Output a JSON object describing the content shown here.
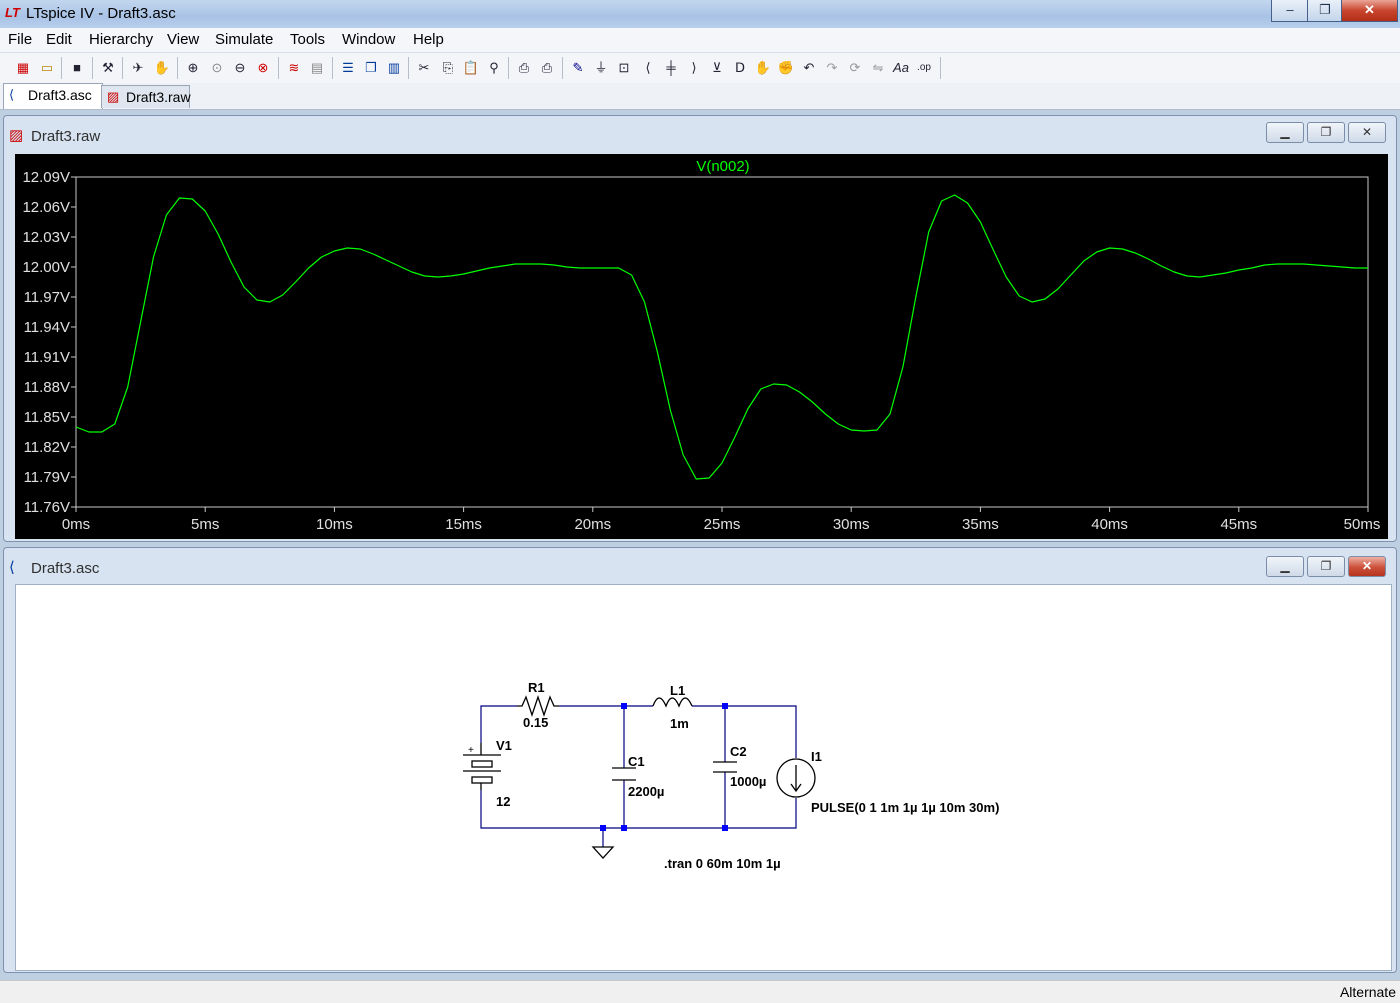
{
  "app": {
    "title": "LTspice IV - Draft3.asc",
    "logo_icon": "ltspice-logo-icon"
  },
  "caption_buttons": {
    "minimize": "–",
    "maximize": "❐",
    "close": "✕"
  },
  "menu": [
    {
      "label": "File"
    },
    {
      "label": "Edit"
    },
    {
      "label": "Hierarchy"
    },
    {
      "label": "View"
    },
    {
      "label": "Simulate"
    },
    {
      "label": "Tools"
    },
    {
      "label": "Window"
    },
    {
      "label": "Help"
    }
  ],
  "toolbar_icons": [
    "new-schematic-icon",
    "open-icon",
    "save-icon",
    "control-panel-icon",
    "run-icon",
    "pan-icon",
    "zoom-in-icon",
    "zoom-area-icon",
    "zoom-out-icon",
    "zoom-cancel-icon",
    "autorange-icon",
    "grid-icon",
    "tile-horizontal-icon",
    "cascade-icon",
    "tile-vertical-icon",
    "cut-icon",
    "copy-icon",
    "paste-icon",
    "find-icon",
    "print-preview-icon",
    "print-icon",
    "wire-icon",
    "ground-icon",
    "label-icon",
    "resistor-icon",
    "capacitor-icon",
    "inductor-icon",
    "diode-icon",
    "component-icon",
    "move-icon",
    "drag-icon",
    "undo-icon",
    "redo-icon",
    "rotate-icon",
    "mirror-icon",
    "text-icon",
    "spice-directive-icon"
  ],
  "tabs": [
    {
      "label": "Draft3.asc",
      "active": true
    },
    {
      "label": "Draft3.raw",
      "active": false
    }
  ],
  "waveform_window": {
    "title": "Draft3.raw",
    "trace_label": "V(n002)"
  },
  "chart_data": {
    "type": "line",
    "title": "V(n002)",
    "xlabel": "",
    "ylabel": "",
    "xlim": [
      0,
      50
    ],
    "ylim": [
      11.76,
      12.09
    ],
    "x_ticks": [
      "0ms",
      "5ms",
      "10ms",
      "15ms",
      "20ms",
      "25ms",
      "30ms",
      "35ms",
      "40ms",
      "45ms",
      "50ms"
    ],
    "y_ticks": [
      "12.09V",
      "12.06V",
      "12.03V",
      "12.00V",
      "11.97V",
      "11.94V",
      "11.91V",
      "11.88V",
      "11.85V",
      "11.82V",
      "11.79V",
      "11.76V"
    ],
    "series": [
      {
        "color": "#00ff00",
        "x": [
          0,
          0.5,
          1,
          1.5,
          2,
          2.5,
          3,
          3.5,
          4,
          4.5,
          5,
          5.5,
          6,
          6.5,
          7,
          7.5,
          8,
          8.5,
          9,
          9.5,
          10,
          10.5,
          11,
          11.5,
          12,
          12.5,
          13,
          13.5,
          14,
          14.5,
          15,
          15.5,
          16,
          16.5,
          17,
          17.5,
          18,
          18.5,
          19,
          19.5,
          20,
          20.5,
          21,
          21.5,
          22,
          22.5,
          23,
          23.5,
          24,
          24.5,
          25,
          25.5,
          26,
          26.5,
          27,
          27.5,
          28,
          28.5,
          29,
          29.5,
          30,
          30.5,
          31,
          31.5,
          32,
          32.5,
          33,
          33.5,
          34,
          34.5,
          35,
          35.5,
          36,
          36.5,
          37,
          37.5,
          38,
          38.5,
          39,
          39.5,
          40,
          40.5,
          41,
          41.5,
          42,
          42.5,
          43,
          43.5,
          44,
          44.5,
          45,
          45.5,
          46,
          46.5,
          47,
          47.5,
          48,
          48.5,
          49,
          49.5,
          50
        ],
        "y": [
          11.84,
          11.835,
          11.835,
          11.843,
          11.88,
          11.945,
          12.01,
          12.052,
          12.069,
          12.068,
          12.056,
          12.033,
          12.005,
          11.98,
          11.967,
          11.965,
          11.972,
          11.985,
          11.999,
          12.01,
          12.016,
          12.019,
          12.018,
          12.013,
          12.007,
          12.001,
          11.995,
          11.991,
          11.99,
          11.991,
          11.993,
          11.996,
          11.999,
          12.001,
          12.003,
          12.003,
          12.003,
          12.002,
          12.0,
          11.999,
          11.999,
          11.999,
          11.999,
          11.992,
          11.965,
          11.915,
          11.857,
          11.812,
          11.788,
          11.789,
          11.804,
          11.83,
          11.858,
          11.878,
          11.883,
          11.882,
          11.875,
          11.865,
          11.853,
          11.843,
          11.837,
          11.836,
          11.837,
          11.853,
          11.9,
          11.97,
          12.035,
          12.066,
          12.072,
          12.064,
          12.045,
          12.017,
          11.99,
          11.971,
          11.965,
          11.968,
          11.978,
          11.992,
          12.006,
          12.015,
          12.019,
          12.018,
          12.014,
          12.008,
          12.001,
          11.995,
          11.991,
          11.99,
          11.992,
          11.994,
          11.997,
          11.999,
          12.002,
          12.003,
          12.003,
          12.003,
          12.002,
          12.001,
          12.0,
          11.999,
          11.999
        ]
      }
    ],
    "grid": false,
    "background": "#000000"
  },
  "schematic_window": {
    "title": "Draft3.asc",
    "components": {
      "r1_name": "R1",
      "r1_value": "0.15",
      "l1_name": "L1",
      "l1_value": "1m",
      "v1_name": "V1",
      "v1_value": "12",
      "v1_plus": "+",
      "c1_name": "C1",
      "c1_value": "2200µ",
      "c2_name": "C2",
      "c2_value": "1000µ",
      "i1_name": "I1",
      "i1_value": "PULSE(0 1 1m 1µ 1µ 10m 30m)"
    },
    "directive": ".tran 0 60m 10m 1µ",
    "wire_color": "#000080",
    "junction_color": "#0000ff",
    "component_color": "#000000"
  },
  "status": {
    "text": "Alternate"
  }
}
